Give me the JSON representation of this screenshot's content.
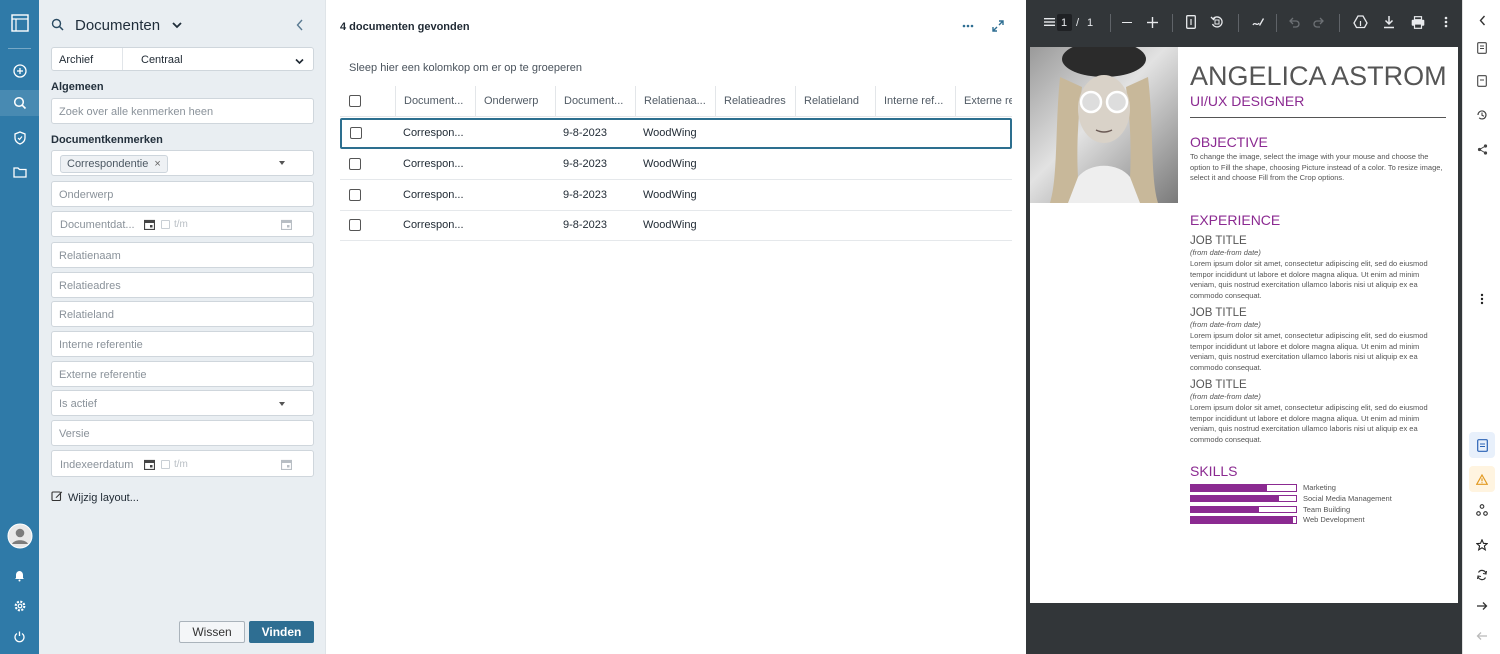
{
  "rail": {
    "items": [
      "logo-icon",
      "add-icon",
      "search-icon",
      "shield-icon",
      "folder-icon",
      "avatar",
      "bell-icon",
      "gear-icon",
      "power-icon"
    ]
  },
  "panel": {
    "title": "Documenten",
    "archive_label": "Archief",
    "archive_value": "Centraal",
    "section_general": "Algemeen",
    "general_placeholder": "Zoek over alle kenmerken heen",
    "section_doc": "Documentkenmerken",
    "chip": "Correspondentie",
    "chip_close": "×",
    "fields": {
      "subject": "Onderwerp",
      "docdate": "Documentdat...",
      "tm1": "t/m",
      "relname": "Relatienaam",
      "reladdr": "Relatieadres",
      "relcountry": "Relatieland",
      "intref": "Interne referentie",
      "extref": "Externe referentie",
      "active": "Is actief",
      "version": "Versie",
      "indexdate": "Indexeerdatum",
      "tm2": "t/m"
    },
    "edit_layout": "Wijzig layout...",
    "clear_button": "Wissen",
    "find_button": "Vinden"
  },
  "results": {
    "count_text": "4 documenten gevonden",
    "group_hint": "Sleep hier een kolomkop om er op te groeperen",
    "columns": [
      "Document...",
      "Onderwerp",
      "Document...",
      "Relatienaa...",
      "Relatieadres",
      "Relatieland",
      "Interne ref...",
      "Externe re"
    ],
    "rows": [
      {
        "type": "Correspon...",
        "subject": "",
        "date": "9-8-2023",
        "relation": "WoodWing"
      },
      {
        "type": "Correspon...",
        "subject": "",
        "date": "9-8-2023",
        "relation": "WoodWing"
      },
      {
        "type": "Correspon...",
        "subject": "",
        "date": "9-8-2023",
        "relation": "WoodWing"
      },
      {
        "type": "Correspon...",
        "subject": "",
        "date": "9-8-2023",
        "relation": "WoodWing"
      }
    ]
  },
  "viewer": {
    "page_current": "1",
    "page_sep": "/",
    "page_total": "1",
    "doc": {
      "name": "ANGELICA ASTROM",
      "role": "UI/UX DESIGNER",
      "objective_h": "OBJECTIVE",
      "objective": "To change the image, select the image with your mouse and choose the option to Fill the shape, choosing Picture instead of a color.  To resize image, select it and choose Fill from the Crop options.",
      "experience_h": "EXPERIENCE",
      "jobs": [
        {
          "title": "JOB TITLE",
          "dates": "(from date-from date)",
          "text": "Lorem ipsum dolor sit amet, consectetur adipiscing elit, sed do eiusmod tempor incididunt ut labore et dolore magna aliqua. Ut enim ad minim veniam, quis nostrud exercitation ullamco laboris nisi ut aliquip ex ea commodo consequat."
        },
        {
          "title": "JOB TITLE",
          "dates": "(from date-from date)",
          "text": "Lorem ipsum dolor sit amet, consectetur adipiscing elit, sed do eiusmod tempor incididunt ut labore et dolore magna aliqua. Ut enim ad minim veniam, quis nostrud exercitation ullamco laboris nisi ut aliquip ex ea commodo consequat."
        },
        {
          "title": "JOB TITLE",
          "dates": "(from date-from date)",
          "text": "Lorem ipsum dolor sit amet, consectetur adipiscing elit, sed do eiusmod tempor incididunt ut labore et dolore magna aliqua. Ut enim ad minim veniam, quis nostrud exercitation ullamco laboris nisi ut aliquip ex ea commodo consequat."
        }
      ],
      "skills_h": "SKILLS",
      "skills": [
        {
          "name": "Marketing",
          "level": 0.72
        },
        {
          "name": "Social Media Management",
          "level": 0.84
        },
        {
          "name": "Team Building",
          "level": 0.65
        },
        {
          "name": "Web Development",
          "level": 0.97
        }
      ]
    }
  },
  "colors": {
    "rail": "#2f7aa8",
    "primary_button": "#2e6e92",
    "viewer_bg": "#323639",
    "resume_accent": "#8b2a91"
  }
}
